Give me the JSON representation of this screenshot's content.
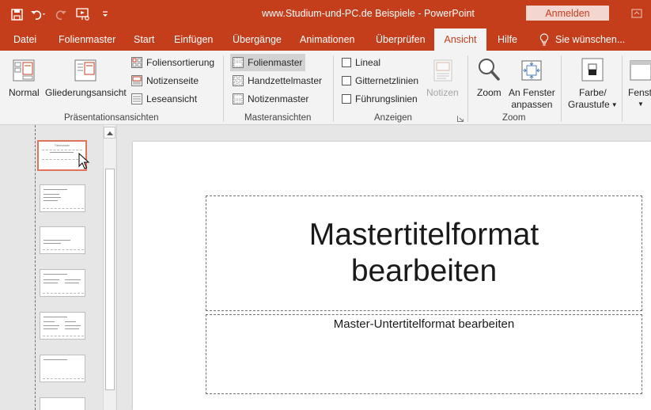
{
  "window": {
    "title": "www.Studium-und-PC.de  Beispiele  -  PowerPoint",
    "signin_label": "Anmelden"
  },
  "quick_access": [
    {
      "name": "save-icon"
    },
    {
      "name": "undo-icon"
    },
    {
      "name": "redo-icon"
    },
    {
      "name": "presentation-start-icon"
    },
    {
      "name": "customize-qat-icon"
    }
  ],
  "tabs": [
    {
      "label": "Datei"
    },
    {
      "label": "Folienmaster"
    },
    {
      "label": "Start"
    },
    {
      "label": "Einfügen"
    },
    {
      "label": "Übergänge"
    },
    {
      "label": "Animationen"
    },
    {
      "label": "Überprüfen"
    },
    {
      "label": "Ansicht",
      "active": true
    },
    {
      "label": "Hilfe"
    }
  ],
  "tell_me": {
    "label": "Sie wünschen..."
  },
  "ribbon": {
    "presentation_views": {
      "label": "Präsentationsansichten",
      "normal": "Normal",
      "outline": "Gliederungsansicht",
      "slide_sorter": "Foliensortierung",
      "notes_page": "Notizenseite",
      "reading_view": "Leseansicht"
    },
    "master_views": {
      "label": "Masteransichten",
      "slide_master": "Folienmaster",
      "handout_master": "Handzettelmaster",
      "notes_master": "Notizenmaster"
    },
    "show": {
      "label": "Anzeigen",
      "ruler": "Lineal",
      "gridlines": "Gitternetzlinien",
      "guides": "Führungslinien",
      "notes": "Notizen"
    },
    "zoom": {
      "label": "Zoom",
      "zoom": "Zoom",
      "fit_line1": "An Fenster",
      "fit_line2": "anpassen"
    },
    "color": {
      "line1": "Farbe/",
      "line2": "Graustufe"
    },
    "window": {
      "label": "Fenst"
    }
  },
  "slide": {
    "title": "Mastertitelformat bearbeiten",
    "subtitle": "Master-Untertitelformat bearbeiten"
  },
  "thumbnails": [
    {
      "name": "layout-thumbnail-title",
      "selected": true,
      "thumb_title": "Titelmaster"
    },
    {
      "name": "layout-thumbnail-content"
    },
    {
      "name": "layout-thumbnail-section"
    },
    {
      "name": "layout-thumbnail-two-content"
    },
    {
      "name": "layout-thumbnail-comparison"
    },
    {
      "name": "layout-thumbnail-title-only"
    },
    {
      "name": "layout-thumbnail-blank"
    }
  ],
  "colors": {
    "accent": "#c43e1c",
    "ribbon_bg": "#f3f3f3",
    "workspace_bg": "#e6e6e6",
    "selection": "#e0745a"
  }
}
